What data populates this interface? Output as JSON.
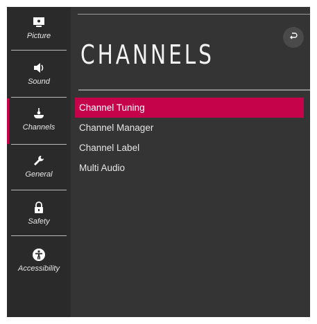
{
  "page": {
    "title": "CHANNELS",
    "accent_color": "#c5034a"
  },
  "sidebar": {
    "items": [
      {
        "label": "Picture",
        "icon": "monitor-icon"
      },
      {
        "label": "Sound",
        "icon": "speaker-icon"
      },
      {
        "label": "Channels",
        "icon": "antenna-icon",
        "active": true
      },
      {
        "label": "General",
        "icon": "wrench-icon"
      },
      {
        "label": "Safety",
        "icon": "lock-icon"
      },
      {
        "label": "Accessibility",
        "icon": "accessibility-icon"
      }
    ]
  },
  "header": {
    "back_icon": "back-arrow-icon"
  },
  "menu": {
    "items": [
      {
        "label": "Channel Tuning",
        "selected": true
      },
      {
        "label": "Channel Manager"
      },
      {
        "label": "Channel Label"
      },
      {
        "label": "Multi Audio"
      }
    ]
  }
}
